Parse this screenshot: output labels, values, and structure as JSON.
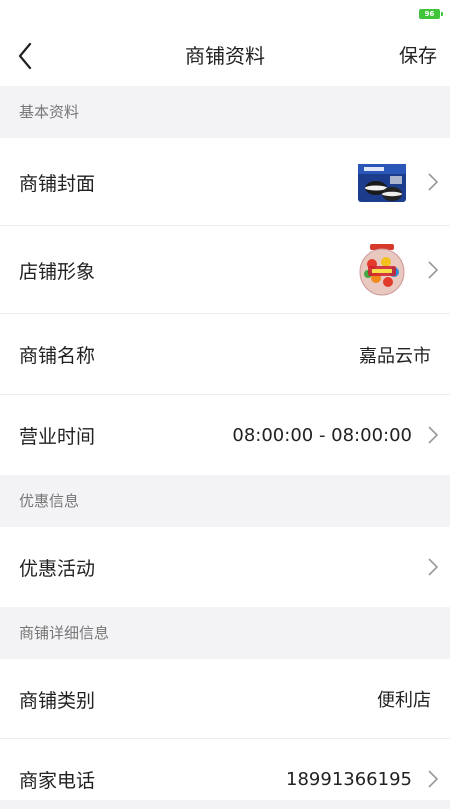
{
  "status_bar": {
    "battery": "96"
  },
  "header": {
    "title": "商铺资料",
    "save_label": "保存"
  },
  "sections": {
    "basic": "基本资料",
    "promo": "优惠信息",
    "detail": "商铺详细信息"
  },
  "rows": {
    "cover": {
      "label": "商铺封面"
    },
    "image": {
      "label": "店铺形象"
    },
    "name": {
      "label": "商铺名称",
      "value": "嘉品云市"
    },
    "hours": {
      "label": "营业时间",
      "value": "08:00:00 - 08:00:00"
    },
    "promo_activity": {
      "label": "优惠活动"
    },
    "category": {
      "label": "商铺类别",
      "value": "便利店"
    },
    "phone": {
      "label": "商家电话",
      "value": "18991366195"
    }
  },
  "colors": {
    "accent_battery": "#3fc43a",
    "background": "#f3f3f6"
  }
}
